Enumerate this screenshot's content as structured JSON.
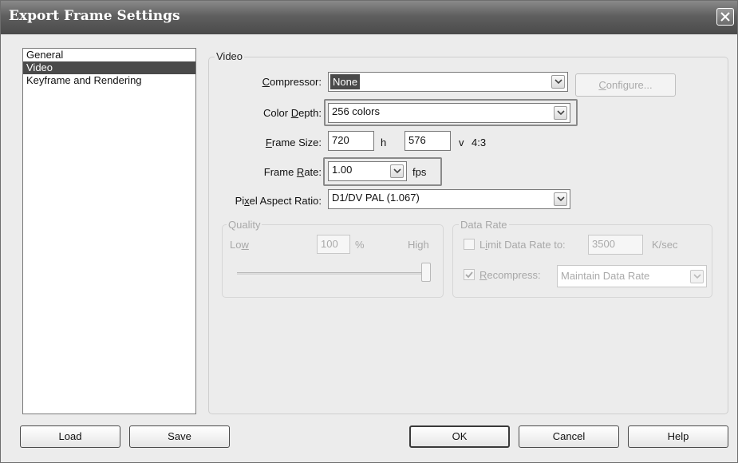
{
  "window": {
    "title": "Export Frame Settings"
  },
  "sidebar": {
    "items": [
      "General",
      "Video",
      "Keyframe and Rendering"
    ],
    "selected": "Video"
  },
  "video": {
    "group_label": "Video",
    "compressor": {
      "label": "Compressor:",
      "value": "None",
      "configure_label": "Configure..."
    },
    "color_depth": {
      "label": "Color Depth:",
      "value": "256 colors"
    },
    "frame_size": {
      "label": "Frame Size:",
      "width": "720",
      "h_label": "h",
      "height": "576",
      "v_label": "v",
      "aspect": "4:3"
    },
    "frame_rate": {
      "label": "Frame Rate:",
      "value": "1.00",
      "unit": "fps"
    },
    "pixel_aspect": {
      "label": "Pixel Aspect Ratio:",
      "value": "D1/DV PAL (1.067)"
    }
  },
  "quality": {
    "group_label": "Quality",
    "low_label": "Low",
    "high_label": "High",
    "value": "100",
    "unit": "%",
    "slider_level": 100
  },
  "data_rate": {
    "group_label": "Data Rate",
    "limit_label": "Limit Data Rate to:",
    "limit_value": "3500",
    "limit_unit": "K/sec",
    "limit_checked": false,
    "recompress_label": "Recompress:",
    "recompress_checked": true,
    "recompress_value": "Maintain Data Rate"
  },
  "footer": {
    "load_label": "Load",
    "save_label": "Save",
    "ok_label": "OK",
    "cancel_label": "Cancel",
    "help_label": "Help"
  },
  "colors": {
    "titlebar": "#5f5f5f",
    "selection": "#4a4a4a",
    "background": "#ececec"
  }
}
